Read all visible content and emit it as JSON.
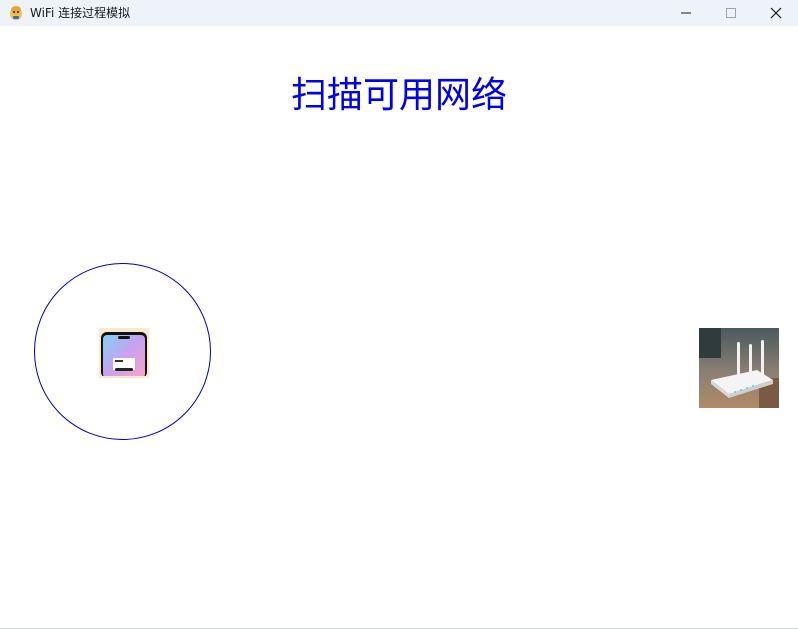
{
  "window": {
    "title": "WiFi 连接过程模拟",
    "controls": {
      "minimize": "minimize-icon",
      "maximize": "maximize-icon",
      "close": "close-icon"
    }
  },
  "scene": {
    "status_text": "扫描可用网络",
    "status_color": "#0000ee",
    "scan_ring_color": "#0000cc",
    "phone_icon": "smartphone-icon",
    "router_icon": "wifi-router-icon"
  }
}
